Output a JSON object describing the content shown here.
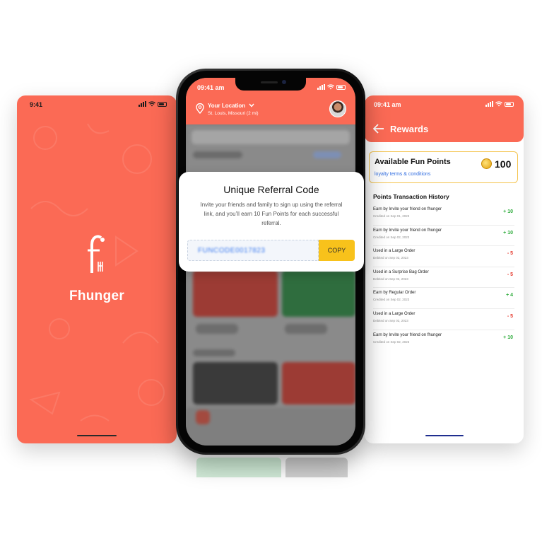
{
  "colors": {
    "brand": "#fb6a55",
    "accent_yellow": "#f8c21b",
    "plus": "#2cab3a",
    "minus": "#e5392d"
  },
  "splash": {
    "time": "9:41",
    "brand_name": "Fhunger",
    "logo_icon": "fhunger-fork-logo-icon"
  },
  "center": {
    "time": "09:41 am",
    "location_label": "Your Location",
    "location_value": "St. Louis, Missouri (2 mi)",
    "modal": {
      "title": "Unique Referral Code",
      "text": "Invite your friends and family to sign up using the referral link, and you’ll earn 10 Fun Points for each successful referral.",
      "code": "FUNCODE0017823",
      "copy_label": "COPY"
    }
  },
  "rewards": {
    "time": "09:41 am",
    "title": "Rewards",
    "available_label": "Available Fun Points",
    "available_value": "100",
    "terms_link": "loyalty terms & conditions",
    "history_title": "Points Transaction History",
    "transactions": [
      {
        "title": "Earn by Invite your friend on fhunger",
        "date": "Credited on Sep 01, 2023",
        "points": "+ 10",
        "kind": "plus"
      },
      {
        "title": "Earn by Invite your friend on fhunger",
        "date": "Credited on Sep 02, 2023",
        "points": "+ 10",
        "kind": "plus"
      },
      {
        "title": "Used in a Large Order",
        "date": "Debited on Sep 02, 2023",
        "points": "- 5",
        "kind": "minus"
      },
      {
        "title": "Used in a Surprise Bag Order",
        "date": "Debited on Sep 02, 2023",
        "points": "- 5",
        "kind": "minus"
      },
      {
        "title": "Earn by Regular Order",
        "date": "Credited on Sep 02, 2023",
        "points": "+ 4",
        "kind": "plus"
      },
      {
        "title": "Used in a Large Order",
        "date": "Debited on Sep 02, 2023",
        "points": "- 5",
        "kind": "minus"
      },
      {
        "title": "Earn by Invite your friend on fhunger",
        "date": "Credited on Sep 02, 2023",
        "points": "+ 10",
        "kind": "plus"
      }
    ]
  }
}
